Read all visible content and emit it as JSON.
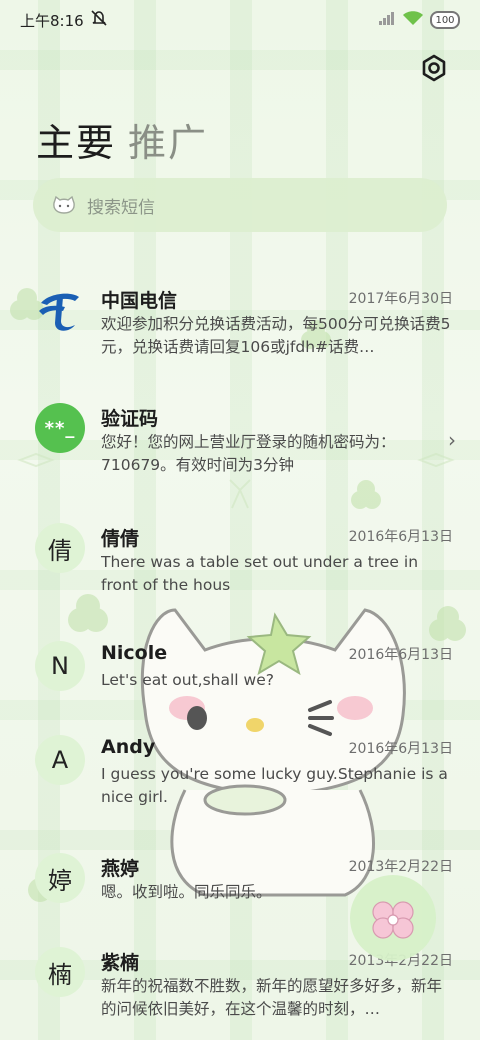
{
  "status_bar": {
    "time": "上午8:16",
    "battery": "100"
  },
  "tabs": [
    {
      "label": "主要"
    },
    {
      "label": "推广"
    }
  ],
  "search": {
    "placeholder": "搜索短信"
  },
  "messages": [
    {
      "name": "中国电信",
      "date": "2017年6月30日",
      "preview": "欢迎参加积分兑换话费活动，每500分可兑换话费5元，兑换话费请回复106或jfdh#话费…",
      "avatar_type": "logo"
    },
    {
      "name": "验证码",
      "date": "",
      "preview": "您好！您的网上营业厅登录的随机密码为：710679。有效时间为3分钟",
      "avatar_text": "**_",
      "avatar_type": "code"
    },
    {
      "name": "倩倩",
      "date": "2016年6月13日",
      "preview": "There was a table set out under a tree in front of the hous",
      "avatar_text": "倩",
      "avatar_type": "letter"
    },
    {
      "name": "Nicole",
      "date": "2016年6月13日",
      "preview": "Let's eat out,shall we?",
      "avatar_text": "N",
      "avatar_type": "letter"
    },
    {
      "name": "Andy",
      "date": "2016年6月13日",
      "preview": "I guess you're some lucky guy.Stephanie is a nice girl.",
      "avatar_text": "A",
      "avatar_type": "letter"
    },
    {
      "name": "燕婷",
      "date": "2013年2月22日",
      "preview": "嗯。收到啦。同乐同乐。",
      "avatar_text": "婷",
      "avatar_type": "letter"
    },
    {
      "name": "紫楠",
      "date": "2013年2月22日",
      "preview": "新年的祝福数不胜数，新年的愿望好多好多，新年的问候依旧美好，在这个温馨的时刻，…",
      "avatar_text": "楠",
      "avatar_type": "letter"
    }
  ],
  "colors": {
    "accent_green": "#55c14f",
    "avatar_bg": "#dff3d5",
    "search_bg": "#dcedd0",
    "telecom_blue": "#1a5fb4"
  },
  "icons": {
    "settings": "hexagon-gear-icon",
    "search": "cat-face-icon",
    "chevron": "chevron-right-icon",
    "compose": "clover-compose-icon"
  }
}
